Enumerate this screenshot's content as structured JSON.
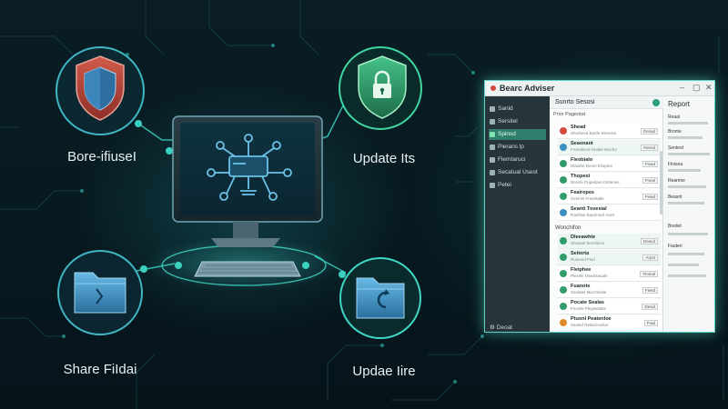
{
  "scene": {
    "features": [
      {
        "label": "Bore-ifiuseI"
      },
      {
        "label": "Update Its"
      },
      {
        "label": "Share FiIdai"
      },
      {
        "label": "Updae Iire"
      }
    ]
  },
  "app": {
    "title": "Bearc Adviser",
    "window_controls": [
      "–",
      "▢",
      "✕"
    ],
    "sidebar": {
      "items": [
        {
          "label": "Sanid"
        },
        {
          "label": "Sersitel"
        },
        {
          "label": "Spinsd"
        },
        {
          "label": "Pieraris lp"
        },
        {
          "label": "Flemtaruci"
        },
        {
          "label": "Secatual Usest"
        },
        {
          "label": "Petei"
        }
      ],
      "active_index": 2,
      "bottom_label": "Deoat"
    },
    "main": {
      "header": "Sunrto Sesosi",
      "tabs": "Prior    Pagentat",
      "section_1": "",
      "rows_1": [
        {
          "title": "Shead",
          "sub": "Shurkeed Bartle Eleserta",
          "button": "Desad"
        },
        {
          "title": "Seaonant",
          "sub": "Frenatiend Dealer Mucho",
          "button": "Nessd"
        },
        {
          "title": "Fleobialo",
          "sub": "Dlauthe Deriel Eliopest",
          "button": "Fiead"
        },
        {
          "title": "Thopest",
          "sub": "Bnoste Pupedare Dsitenes",
          "button": "Fneal"
        },
        {
          "title": "Feairopes",
          "sub": "Ovierkit Frestrtatle",
          "button": "Fiead"
        },
        {
          "title": "Seanti Tovesial",
          "sub": "Ranfitse Buprimed Aoirs",
          "button": ""
        }
      ],
      "section_2": "Wonchifon",
      "rows_2": [
        {
          "title": "Dleeawhte",
          "sub": "Sheaset fevrelinns",
          "button": "Deacd"
        },
        {
          "title": "Seiterta",
          "sub": "Rutseed Flod",
          "button": "Arpst"
        },
        {
          "title": "Fleiphee",
          "sub": "Pleselir Dsedrrauale",
          "button": "Flomal"
        },
        {
          "title": "Fuanote",
          "sub": "Seaiatel Mecrtieslat",
          "button": "Fiesd"
        },
        {
          "title": "Pocate Sealas",
          "sub": "Fnovlei Plegtaloitite",
          "button": "Desid"
        },
        {
          "title": "Ptuonl Peatenloe",
          "sub": "Sasted Relarcinsdue",
          "button": "Frad"
        }
      ]
    },
    "report": {
      "title": "Report",
      "labels": [
        "Reaal",
        "Bronte",
        "Sentest",
        "Finisea",
        "Reanme",
        "Beasnt",
        "Bredet",
        "Fauteri"
      ]
    }
  },
  "colors": {
    "accent": "#5fd2c7",
    "shield_red": "#c0473c",
    "shield_green": "#2f9c6a",
    "folder_blue": "#3f8fc4"
  }
}
